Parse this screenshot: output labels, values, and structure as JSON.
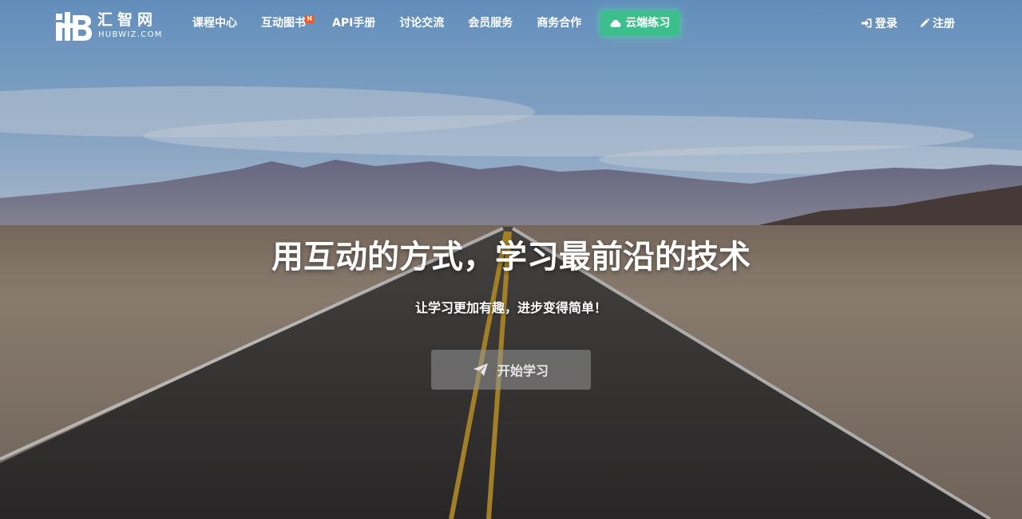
{
  "brand": {
    "name_cn": "汇智网",
    "name_en": "HUBWIZ.COM",
    "mark_icon": "hb-logo-icon"
  },
  "nav": {
    "items": [
      {
        "label": "课程中心"
      },
      {
        "label": "互动图书",
        "badge": "H"
      },
      {
        "label": "API手册"
      },
      {
        "label": "讨论交流"
      },
      {
        "label": "会员服务"
      },
      {
        "label": "商务合作"
      }
    ],
    "cloud_button": {
      "label": "云端练习",
      "icon": "cloud-icon",
      "color": "#3cbf8c"
    }
  },
  "auth": {
    "login": {
      "label": "登录",
      "icon": "sign-in-icon"
    },
    "register": {
      "label": "注册",
      "icon": "pencil-icon"
    }
  },
  "hero": {
    "headline": "用互动的方式，学习最前沿的技术",
    "subline": "让学习更加有趣，进步变得简单！",
    "cta": {
      "label": "开始学习",
      "icon": "paper-plane-icon"
    }
  },
  "colors": {
    "badge": "#e85c2b",
    "accent": "#3cbf8c"
  }
}
